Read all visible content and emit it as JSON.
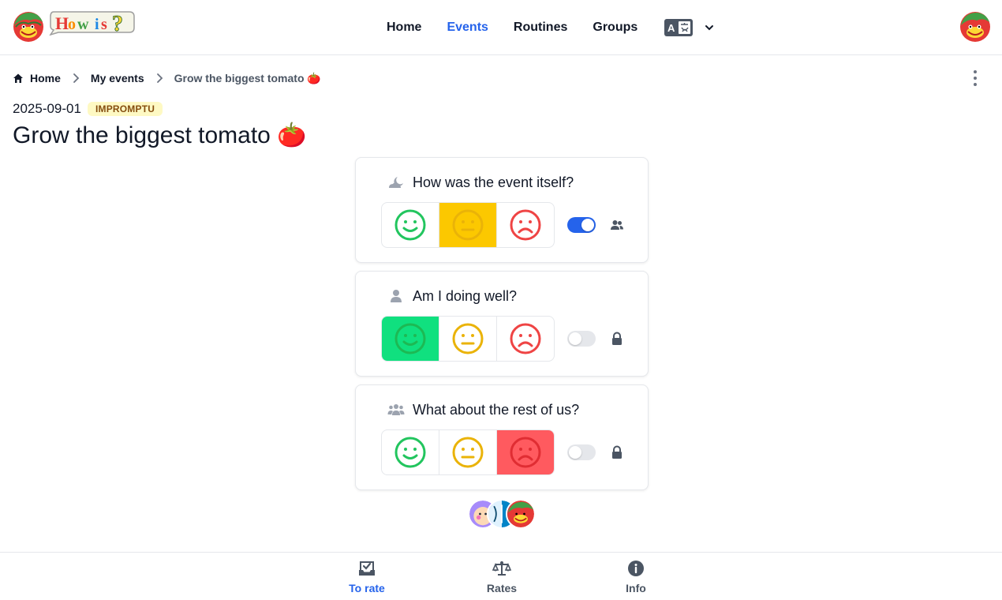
{
  "app": {
    "logo_text": "How is?",
    "user_avatar_icon": "tomato-mascot-avatar"
  },
  "nav": {
    "items": [
      {
        "label": "Home",
        "active": false
      },
      {
        "label": "Events",
        "active": true
      },
      {
        "label": "Routines",
        "active": false
      },
      {
        "label": "Groups",
        "active": false
      }
    ],
    "language_icon": "translate-icon"
  },
  "breadcrumb": {
    "items": [
      "Home",
      "My events"
    ],
    "current": "Grow the biggest tomato 🍅"
  },
  "event": {
    "date": "2025-09-01",
    "badge": "IMPROMPTU",
    "title": "Grow the biggest tomato 🍅"
  },
  "questions": [
    {
      "icon": "weather-night-icon",
      "text": "How was the event itself?",
      "selected": "mid",
      "shared": true,
      "side_icon": "people-icon"
    },
    {
      "icon": "person-icon",
      "text": "Am I doing well?",
      "selected": "good",
      "shared": false,
      "side_icon": "lock-icon"
    },
    {
      "icon": "group-icon",
      "text": "What about the rest of us?",
      "selected": "bad",
      "shared": false,
      "side_icon": "lock-icon"
    }
  ],
  "participants_count": 3,
  "bottom_tabs": [
    {
      "label": "To rate",
      "icon": "inbox-check-icon",
      "active": true
    },
    {
      "label": "Rates",
      "icon": "scale-icon",
      "active": false
    },
    {
      "label": "Info",
      "icon": "info-icon",
      "active": false
    }
  ],
  "colors": {
    "accent": "#2563eb",
    "good": "#10e07f",
    "mid": "#fcc800",
    "bad": "#ff5a5f",
    "good_face": "#22c55e",
    "mid_face": "#eab308",
    "bad_face": "#ef4444"
  }
}
